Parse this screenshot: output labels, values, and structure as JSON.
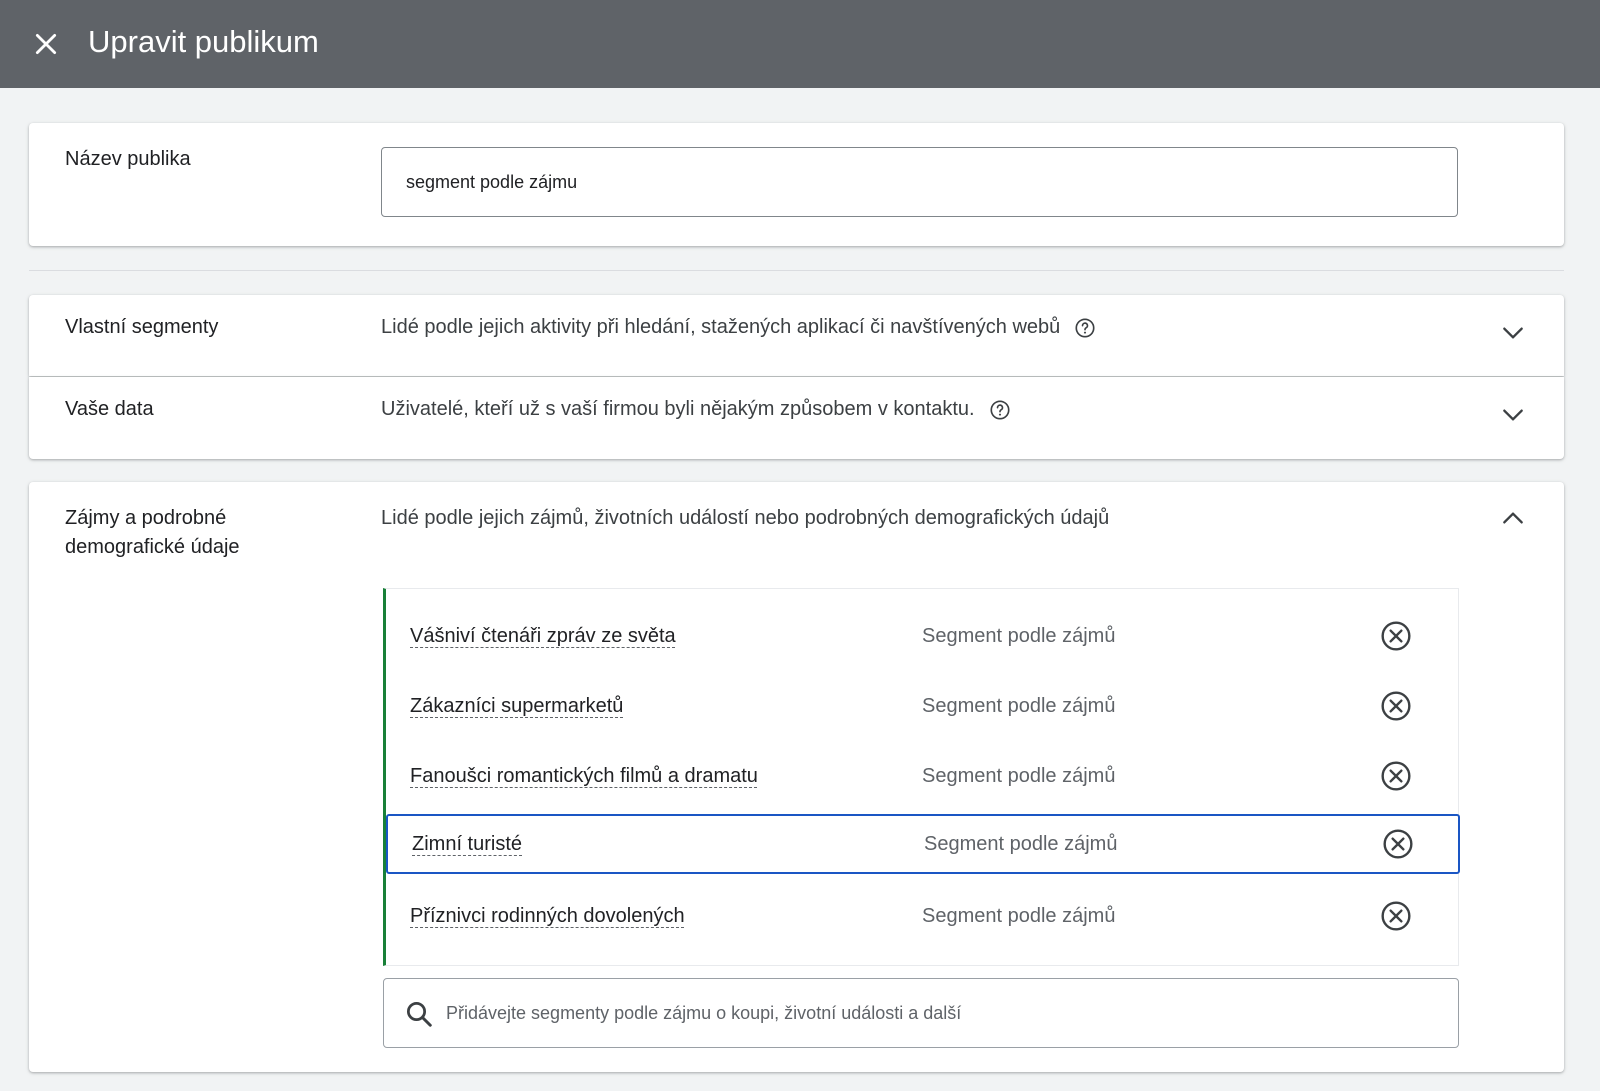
{
  "header": {
    "title": "Upravit publikum"
  },
  "audience_name": {
    "label": "Název publika",
    "value": "segment podle zájmu"
  },
  "custom_segments": {
    "label": "Vlastní segmenty",
    "description": "Lidé podle jejich aktivity při hledání, stažených aplikací či navštívených webů"
  },
  "your_data": {
    "label": "Vaše data",
    "description": "Uživatelé, kteří už s vaší firmou byli nějakým způsobem v kontaktu."
  },
  "interests": {
    "label_line1": "Zájmy a podrobné",
    "label_line2": "demografické údaje",
    "description": "Lidé podle jejich zájmů, životních událostí nebo podrobných demografických údajů",
    "segments": [
      {
        "name": "Vášniví čtenáři zpráv ze světa",
        "type": "Segment podle zájmů"
      },
      {
        "name": "Zákazníci supermarketů",
        "type": "Segment podle zájmů"
      },
      {
        "name": "Fanoušci romantických filmů a dramatu",
        "type": "Segment podle zájmů"
      },
      {
        "name": "Zimní turisté",
        "type": "Segment podle zájmů"
      },
      {
        "name": "Příznivci rodinných dovolených",
        "type": "Segment podle zájmů"
      }
    ],
    "search_placeholder": "Přidávejte segmenty podle zájmu o koupi, životní události a další"
  },
  "icons": {
    "close": "close-icon",
    "help": "help-circle-icon",
    "chevron_down": "chevron-down-icon",
    "chevron_up": "chevron-up-icon",
    "remove": "remove-circle-icon",
    "search": "search-icon"
  },
  "colors": {
    "header_bg": "#5f6368",
    "accent_green": "#188038",
    "selection_blue": "#1a56c4"
  }
}
